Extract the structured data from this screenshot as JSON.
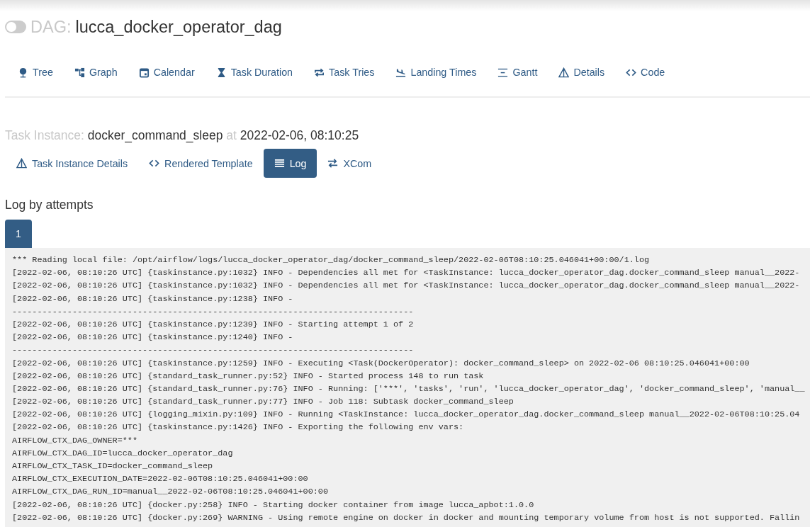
{
  "dag": {
    "on": false,
    "label": "DAG:",
    "name": "lucca_docker_operator_dag"
  },
  "nav": [
    {
      "kind": "tree",
      "label": "Tree"
    },
    {
      "kind": "graph",
      "label": "Graph"
    },
    {
      "kind": "calendar",
      "label": "Calendar"
    },
    {
      "kind": "hourglass",
      "label": "Task Duration"
    },
    {
      "kind": "repeat",
      "label": "Task Tries"
    },
    {
      "kind": "landing",
      "label": "Landing Times"
    },
    {
      "kind": "gantt",
      "label": "Gantt"
    },
    {
      "kind": "warning",
      "label": "Details"
    },
    {
      "kind": "code",
      "label": "Code"
    }
  ],
  "task_instance": {
    "label": "Task Instance:",
    "task": "docker_command_sleep",
    "at": "at",
    "date": "2022-02-06, 08:10:25"
  },
  "ti_tabs": [
    {
      "kind": "warning",
      "label": "Task Instance Details",
      "selected": false
    },
    {
      "kind": "code",
      "label": "Rendered Template",
      "selected": false
    },
    {
      "kind": "list",
      "label": "Log",
      "selected": true
    },
    {
      "kind": "swap",
      "label": "XCom",
      "selected": false
    }
  ],
  "log_heading": "Log by attempts",
  "attempts": [
    {
      "label": "1",
      "selected": true
    }
  ],
  "log_lines": [
    "*** Reading local file: /opt/airflow/logs/lucca_docker_operator_dag/docker_command_sleep/2022-02-06T08:10:25.046041+00:00/1.log",
    "[2022-02-06, 08:10:26 UTC] {taskinstance.py:1032} INFO - Dependencies all met for <TaskInstance: lucca_docker_operator_dag.docker_command_sleep manual__2022-",
    "[2022-02-06, 08:10:26 UTC] {taskinstance.py:1032} INFO - Dependencies all met for <TaskInstance: lucca_docker_operator_dag.docker_command_sleep manual__2022-",
    "[2022-02-06, 08:10:26 UTC] {taskinstance.py:1238} INFO - ",
    "--------------------------------------------------------------------------------",
    "[2022-02-06, 08:10:26 UTC] {taskinstance.py:1239} INFO - Starting attempt 1 of 2",
    "[2022-02-06, 08:10:26 UTC] {taskinstance.py:1240} INFO - ",
    "--------------------------------------------------------------------------------",
    "[2022-02-06, 08:10:26 UTC] {taskinstance.py:1259} INFO - Executing <Task(DockerOperator): docker_command_sleep> on 2022-02-06 08:10:25.046041+00:00",
    "[2022-02-06, 08:10:26 UTC] {standard_task_runner.py:52} INFO - Started process 148 to run task",
    "[2022-02-06, 08:10:26 UTC] {standard_task_runner.py:76} INFO - Running: ['***', 'tasks', 'run', 'lucca_docker_operator_dag', 'docker_command_sleep', 'manual__",
    "[2022-02-06, 08:10:26 UTC] {standard_task_runner.py:77} INFO - Job 118: Subtask docker_command_sleep",
    "[2022-02-06, 08:10:26 UTC] {logging_mixin.py:109} INFO - Running <TaskInstance: lucca_docker_operator_dag.docker_command_sleep manual__2022-02-06T08:10:25.04",
    "[2022-02-06, 08:10:26 UTC] {taskinstance.py:1426} INFO - Exporting the following env vars:",
    "AIRFLOW_CTX_DAG_OWNER=***",
    "AIRFLOW_CTX_DAG_ID=lucca_docker_operator_dag",
    "AIRFLOW_CTX_TASK_ID=docker_command_sleep",
    "AIRFLOW_CTX_EXECUTION_DATE=2022-02-06T08:10:25.046041+00:00",
    "AIRFLOW_CTX_DAG_RUN_ID=manual__2022-02-06T08:10:25.046041+00:00",
    "[2022-02-06, 08:10:26 UTC] {docker.py:258} INFO - Starting docker container from image lucca_apbot:1.0.0",
    "[2022-02-06, 08:10:26 UTC] {docker.py:269} WARNING - Using remote engine on docker in docker and mounting temporary volume from host is not supported. Fallin"
  ]
}
